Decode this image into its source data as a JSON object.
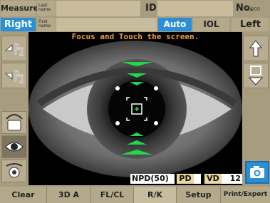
{
  "header": {
    "measure_label": "Measure",
    "last_name_label": "Last\nname",
    "first_name_label": "First\nname",
    "id_label": "ID",
    "no_label": "No.",
    "no_value": "00000",
    "eye_right": "Right",
    "eye_left": "Left",
    "auto_label": "Auto",
    "iol_label": "IOL"
  },
  "view": {
    "instruction": "Focus and Touch the screen."
  },
  "readouts": {
    "npd_label": "NPD(50)",
    "pd_label": "PD",
    "vd_label": "VD",
    "vd_value": "12"
  },
  "footer": {
    "buttons": [
      "Clear",
      "3D A",
      "FL/CL",
      "R/K",
      "Setup",
      "Print/Export"
    ]
  },
  "colors": {
    "accent_blue": "#2a8fd6",
    "panel_tan": "#a89c7e",
    "instruction_orange": "#f2a035",
    "alignment_green": "#22d84a"
  },
  "icons": {
    "left_column": [
      "move-up-eye-icon",
      "move-down-eye-icon",
      "upper-eyelid-icon",
      "eye-open-icon",
      "lower-eyelid-icon"
    ],
    "right_column": [
      "move-up-arrow-icon",
      "move-down-arrow-icon",
      "camera-icon"
    ]
  }
}
